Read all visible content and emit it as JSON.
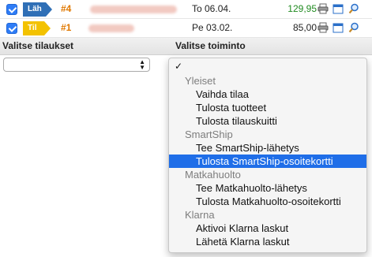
{
  "orders": [
    {
      "status_tag": "Läh",
      "status_color": "#2f6fb6",
      "order_number": "#4",
      "date": "To 06.04.",
      "amount": "129,95",
      "amount_color": "#1f8a1f",
      "checked": true
    },
    {
      "status_tag": "Til",
      "status_color": "#f3c200",
      "order_number": "#1",
      "date": "Pe 03.02.",
      "amount": "85,00",
      "amount_color": "#222222",
      "checked": true
    }
  ],
  "row_icons": [
    "printer-icon",
    "calendar-icon",
    "search-icon"
  ],
  "sections": {
    "select_orders_title": "Valitse tilaukset",
    "select_action_title": "Valitse toiminto"
  },
  "orders_select": {
    "value": ""
  },
  "action_dropdown": {
    "checkmark": "✓",
    "groups": [
      {
        "label": "Yleiset",
        "items": [
          "Vaihda tilaa",
          "Tulosta tuotteet",
          "Tulosta tilauskuitti"
        ]
      },
      {
        "label": "SmartShip",
        "items": [
          "Tee SmartShip-lähetys",
          "Tulosta SmartShip-osoitekortti"
        ]
      },
      {
        "label": "Matkahuolto",
        "items": [
          "Tee Matkahuolto-lähetys",
          "Tulosta Matkahuolto-osoitekortti"
        ]
      },
      {
        "label": "Klarna",
        "items": [
          "Aktivoi Klarna laskut",
          "Lähetä Klarna laskut"
        ]
      }
    ],
    "highlighted_item": "Tulosta SmartShip-osoitekortti"
  },
  "colors": {
    "accent_blue": "#2f6fb6",
    "accent_yellow": "#f3c200",
    "order_number": "#e07800",
    "selection": "#1f6ee8"
  }
}
